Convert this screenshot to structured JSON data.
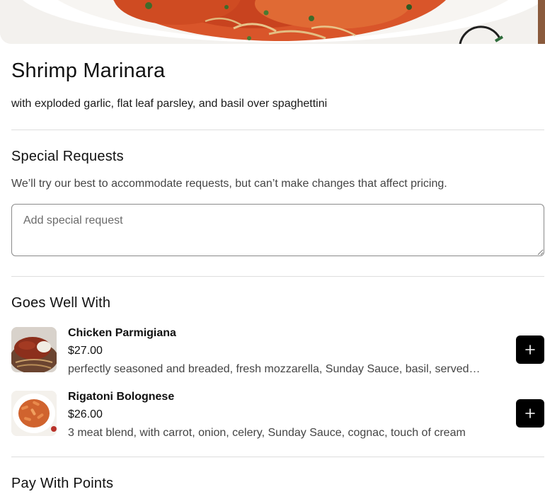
{
  "item": {
    "hero_image": "shrimp-marinara-photo",
    "title": "Shrimp Marinara",
    "description": "with exploded garlic, flat leaf parsley, and basil over spaghettini"
  },
  "special_requests": {
    "heading": "Special Requests",
    "help_text": "We’ll try our best to accommodate requests, but can’t make changes that affect pricing.",
    "placeholder": "Add special request",
    "value": ""
  },
  "goes_well_with": {
    "heading": "Goes Well With",
    "items": [
      {
        "name": "Chicken Parmigiana",
        "price": "$27.00",
        "description": "perfectly seasoned and breaded, fresh mozzarella, Sunday Sauce, basil, served…",
        "image": "chicken-parmigiana-photo",
        "add_icon": "plus-icon"
      },
      {
        "name": "Rigatoni Bolognese",
        "price": "$26.00",
        "description": "3 meat blend, with carrot, onion, celery, Sunday Sauce, cognac, touch of cream",
        "image": "rigatoni-bolognese-photo",
        "add_icon": "plus-icon"
      }
    ]
  },
  "pay_with_points": {
    "heading": "Pay With Points"
  },
  "colors": {
    "button_bg": "#000000",
    "divider": "#dedede",
    "text_primary": "#111111",
    "text_secondary": "#444444"
  }
}
